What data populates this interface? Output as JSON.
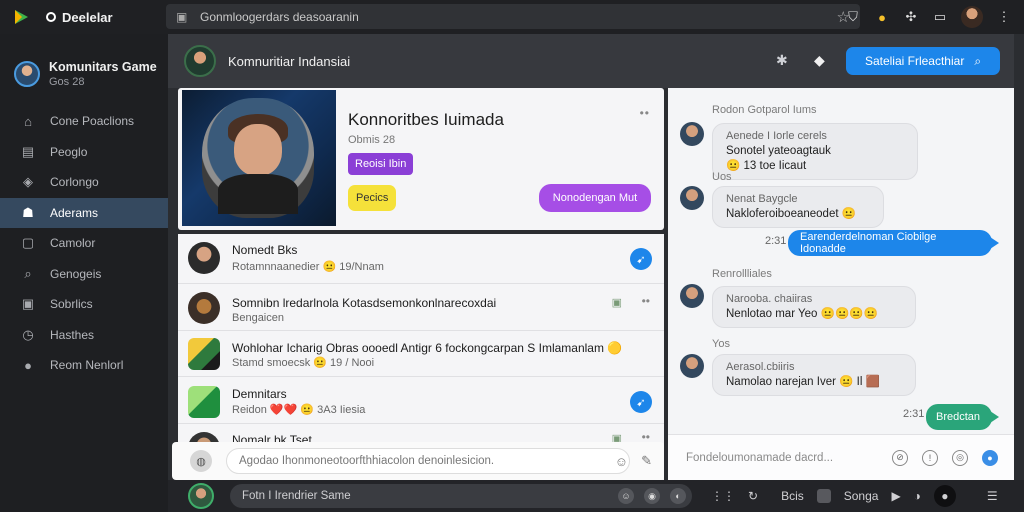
{
  "browser": {
    "title": "Deelelar",
    "url": "Gonmloogerdars deasoaranin",
    "star": "☆"
  },
  "sidebar": {
    "user_name": "Komunitars Game",
    "user_sub": "Gos 28",
    "items": [
      {
        "label": "Cone Poaclions",
        "icon": "home-icon"
      },
      {
        "label": "Peoglo",
        "icon": "people-icon"
      },
      {
        "label": "Corlongo",
        "icon": "tag-icon"
      },
      {
        "label": "Aderams",
        "icon": "users-icon"
      },
      {
        "label": "Camolor",
        "icon": "chat-icon"
      },
      {
        "label": "Genogeis",
        "icon": "search-icon"
      },
      {
        "label": "Sobrlics",
        "icon": "list-icon"
      },
      {
        "label": "Hasthes",
        "icon": "clock-icon"
      },
      {
        "label": "Reom Nenlorl",
        "icon": "info-icon"
      }
    ],
    "active_index": 3
  },
  "header": {
    "title": "Komnuritiar Indansiai",
    "search_button": "Sateliai Frleacthiar"
  },
  "profile": {
    "title": "Konnoritbes Iuimada",
    "subtitle": "Obmis 28",
    "tag": "Reoisi Ibin",
    "yellow_button": "Pecics",
    "purple_button": "Nonodengan Mut",
    "more": "••"
  },
  "feed": [
    {
      "title": "Nomedt Bks",
      "meta": "Rotamnnaanedier 😐 19/Nnam",
      "action": "blue"
    },
    {
      "title": "Somnibn lredarlnola Kotasdsemonkonlnarecoxdai",
      "meta": "Bengaicen",
      "action": "more"
    },
    {
      "title": "Wohlohar Icharig Obras oooedl Antigr 6 fockongcarpan S Imlamanlam 🟡",
      "meta": "Stamd smoecsk 😐 19 / Nooi",
      "action": "more"
    },
    {
      "title": "Demnitars",
      "meta": "Reidon ❤️❤️ 😐 3A3 Iiesia",
      "action": "blue"
    },
    {
      "title": "Nomalr bk Tset",
      "meta": "",
      "action": "more"
    }
  ],
  "compose": {
    "placeholder": "Agodao Ihonmoneotoorfthhiacolon denoinlesicion."
  },
  "chat": {
    "label_top": "Rodon Gotparol Iums",
    "label_mid1": "Uos",
    "label_mid2": "Renrollliales",
    "label_mid3": "Yos",
    "messages": [
      {
        "line1": "Aenede I Iorle cerels",
        "line2": "Sonotel yateoagtauk",
        "line3": "😐 13 toe Iicaut"
      },
      {
        "line1": "Nenat Baygcle",
        "line2": "Nakloferoiboeaneodet 😐"
      },
      {
        "line1": "Narooba. chaiiras",
        "line2": "Nenlotao mar Yeo 😐😐😐😐"
      },
      {
        "line1": "Aerasol.cbiiris",
        "line2": "Namolao narejan Iver 😐 Il 🟫"
      }
    ],
    "outgoing": [
      {
        "time": "2:31",
        "text": "Earenderdelnoman Ciobilge Idonadde"
      },
      {
        "time": "2:31",
        "text": "Bredctan"
      }
    ],
    "input_placeholder": "Fondeloumonamade dacrd..."
  },
  "bottom": {
    "input": "Fotn I Irendrier Same",
    "label1": "Bcis",
    "label2": "Songa"
  }
}
